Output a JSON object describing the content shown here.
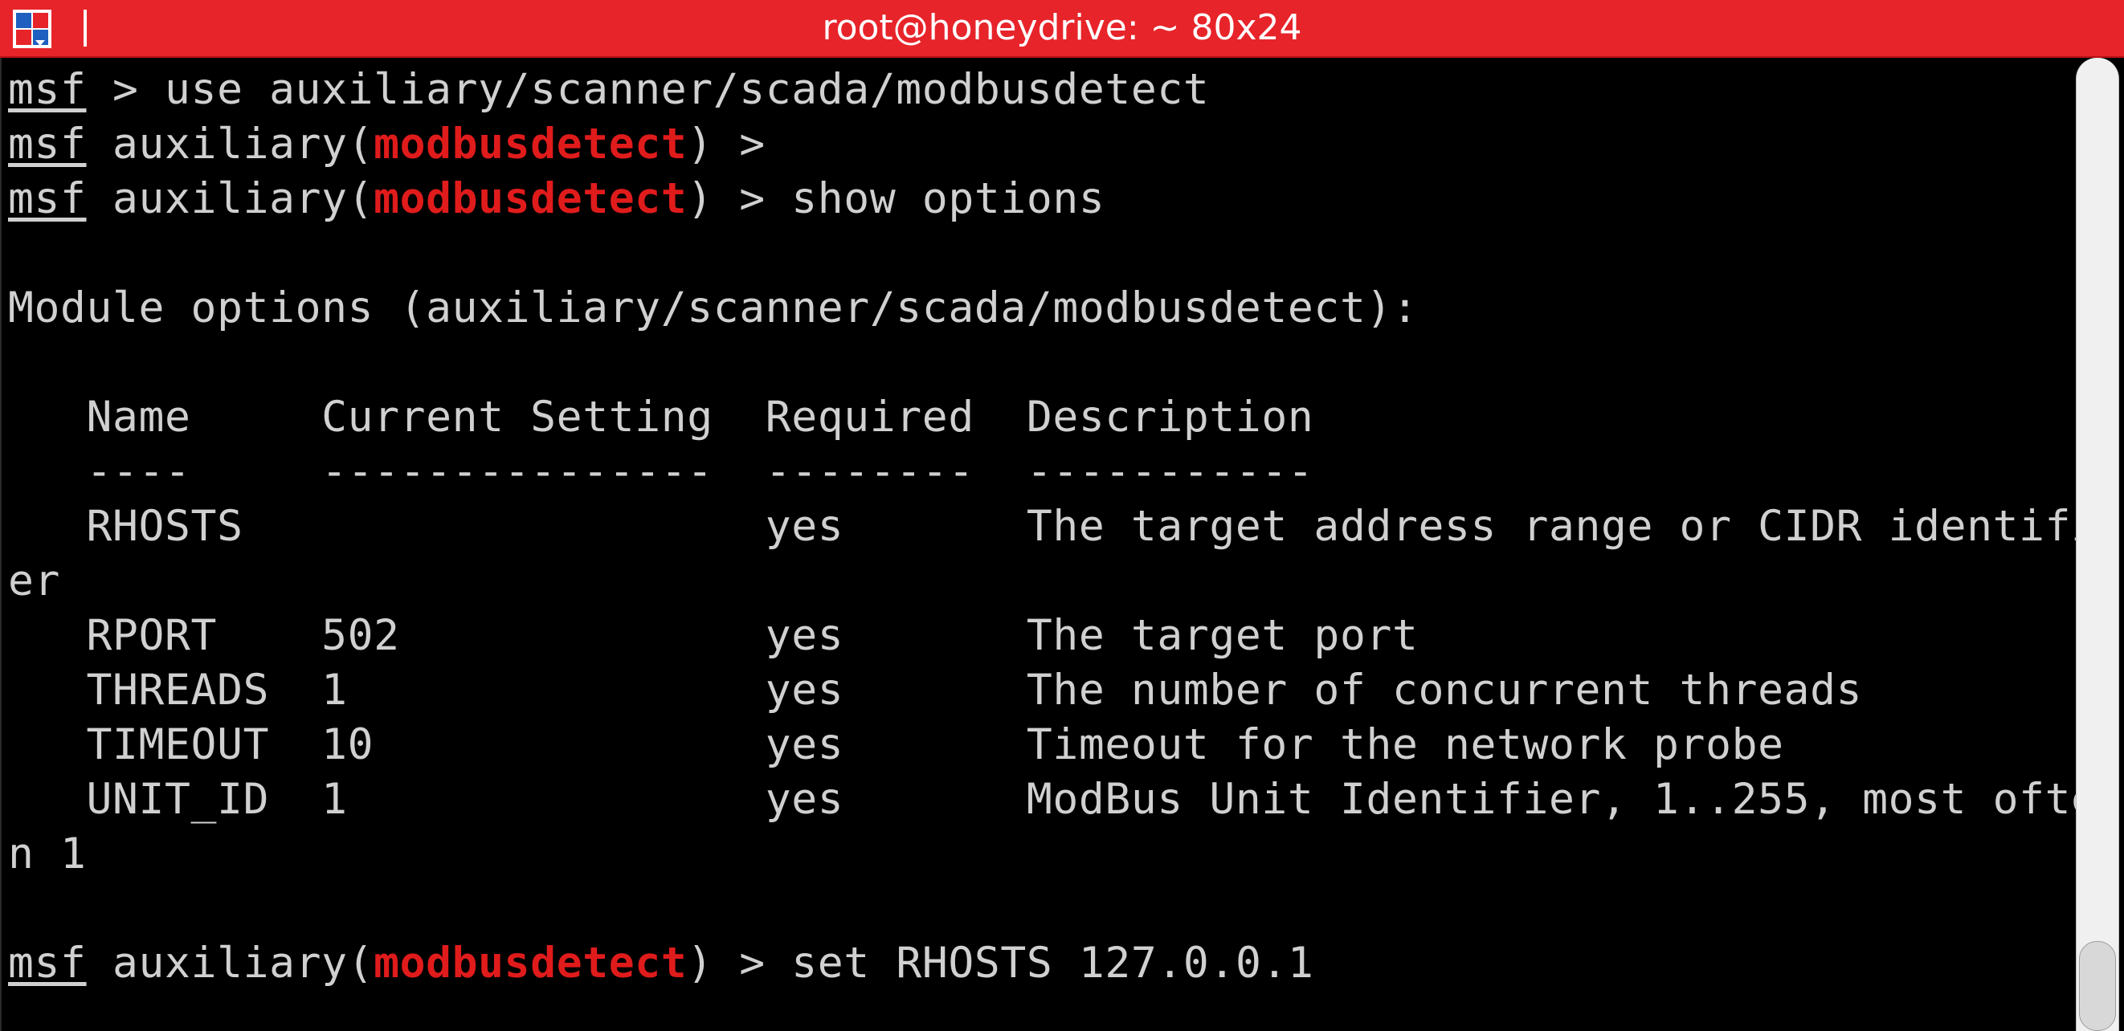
{
  "window": {
    "title": "root@honeydrive: ~ 80x24"
  },
  "prompt": {
    "msf": "msf",
    "module_prefix": " auxiliary(",
    "module": "modbusdetect",
    "module_suffix": ") >"
  },
  "lines": {
    "l1_cmd": " > use auxiliary/scanner/scada/modbusdetect",
    "l2_cmd": "",
    "l3_cmd": " show options",
    "heading": "Module options (auxiliary/scanner/scada/modbusdetect):",
    "table_header": "   Name     Current Setting  Required  Description",
    "table_rule": "   ----     ---------------  --------  -----------",
    "row_rhosts": "   RHOSTS                    yes       The target address range or CIDR identifi",
    "row_rhosts_wrap": "er",
    "row_rport": "   RPORT    502              yes       The target port",
    "row_threads": "   THREADS  1                yes       The number of concurrent threads",
    "row_timeout": "   TIMEOUT  10               yes       Timeout for the network probe",
    "row_unitid": "   UNIT_ID  1                yes       ModBus Unit Identifier, 1..255, most ofte",
    "row_unitid_wrap": "n 1",
    "last_cmd": " set RHOSTS 127.0.0.1"
  },
  "colors": {
    "titlebar": "#e7242a",
    "module_name": "#e01b1b",
    "text": "#d0d0d0",
    "background": "#000000"
  },
  "icons": {
    "app": "terminal-app-icon"
  }
}
